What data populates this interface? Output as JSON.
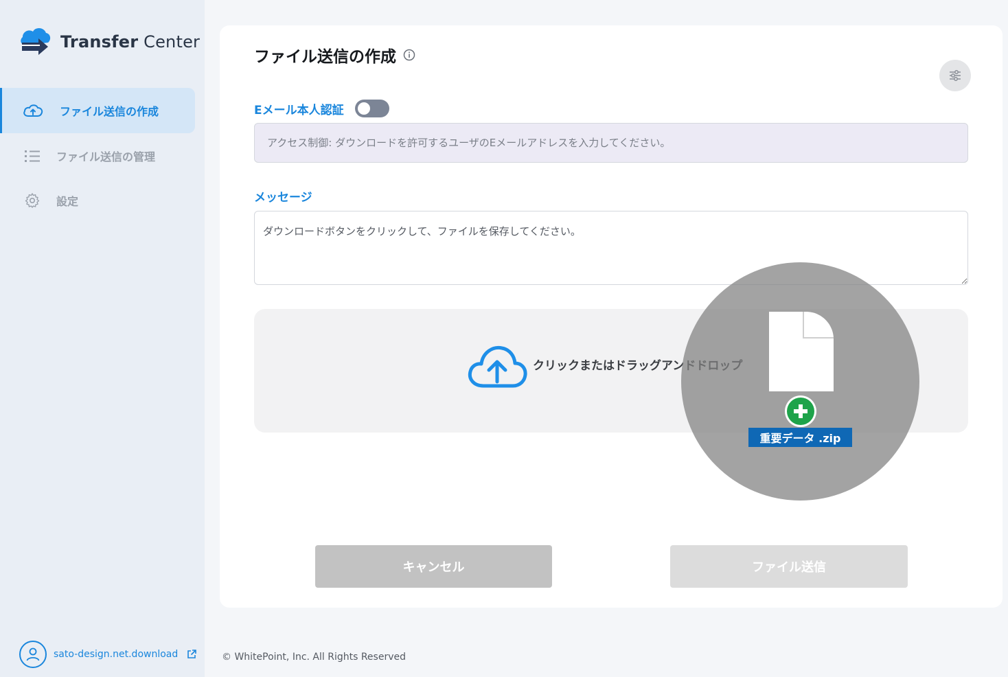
{
  "app": {
    "name_part1": "Transfer",
    "name_part2": " Center",
    "logo_icon": "cloud-arrow-logo"
  },
  "sidebar": {
    "items": [
      {
        "label": "ファイル送信の作成",
        "icon": "cloud-upload-icon",
        "active": true
      },
      {
        "label": "ファイル送信の管理",
        "icon": "list-icon",
        "active": false
      },
      {
        "label": "設定",
        "icon": "gear-icon",
        "active": false
      }
    ],
    "user": {
      "name": "sato-design.net.download",
      "icon": "user-icon",
      "link_icon": "external-link-icon"
    }
  },
  "main": {
    "title": "ファイル送信の作成",
    "title_icon": "info-icon",
    "settings_icon": "sliders-icon",
    "email_auth": {
      "label": "Eメール本人認証",
      "enabled": false
    },
    "email_input": {
      "placeholder": "アクセス制御: ダウンロードを許可するユーザのEメールアドレスを入力してください。",
      "value": ""
    },
    "message": {
      "label": "メッセージ",
      "value": "ダウンロードボタンをクリックして、ファイルを保存してください。"
    },
    "dropzone": {
      "text": "クリックまたはドラッグアンドドロップ",
      "icon": "cloud-upload-icon"
    },
    "cancel_label": "キャンセル",
    "send_label": "ファイル送信"
  },
  "drag": {
    "file_name": "重要データ .zip",
    "file_icon": "document-icon",
    "badge_icon": "plus-icon"
  },
  "footer": {
    "text": "© WhitePoint, Inc. All Rights Reserved"
  },
  "colors": {
    "accent": "#1a86dc",
    "sidebar_bg": "#e9eef5",
    "active_bg": "#d4e6f7",
    "badge_green": "#1ea34a",
    "filename_bg": "#0f68b5"
  }
}
